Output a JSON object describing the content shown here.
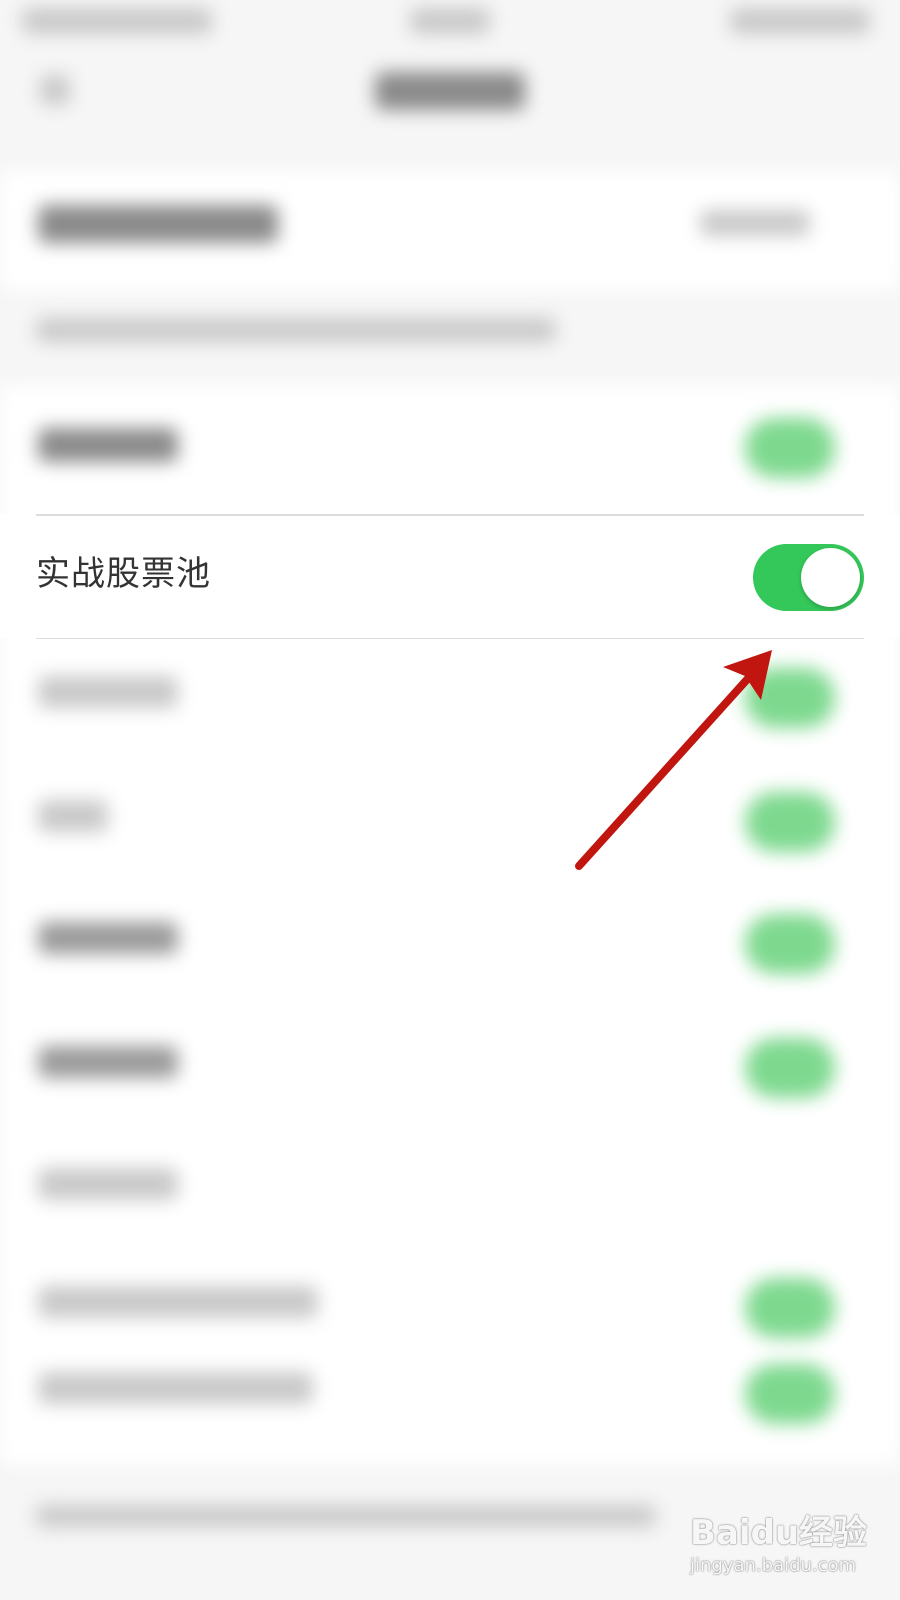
{
  "settings": {
    "stock_pool_row": {
      "label": "实战股票池",
      "toggle_on": true
    }
  },
  "colors": {
    "toggle_on": "#34c759",
    "arrow": "#c0160f",
    "background": "#f6f6f6"
  },
  "watermark": {
    "logo_text": "Baidu经验",
    "url_text": "jingyan.baidu.com"
  }
}
